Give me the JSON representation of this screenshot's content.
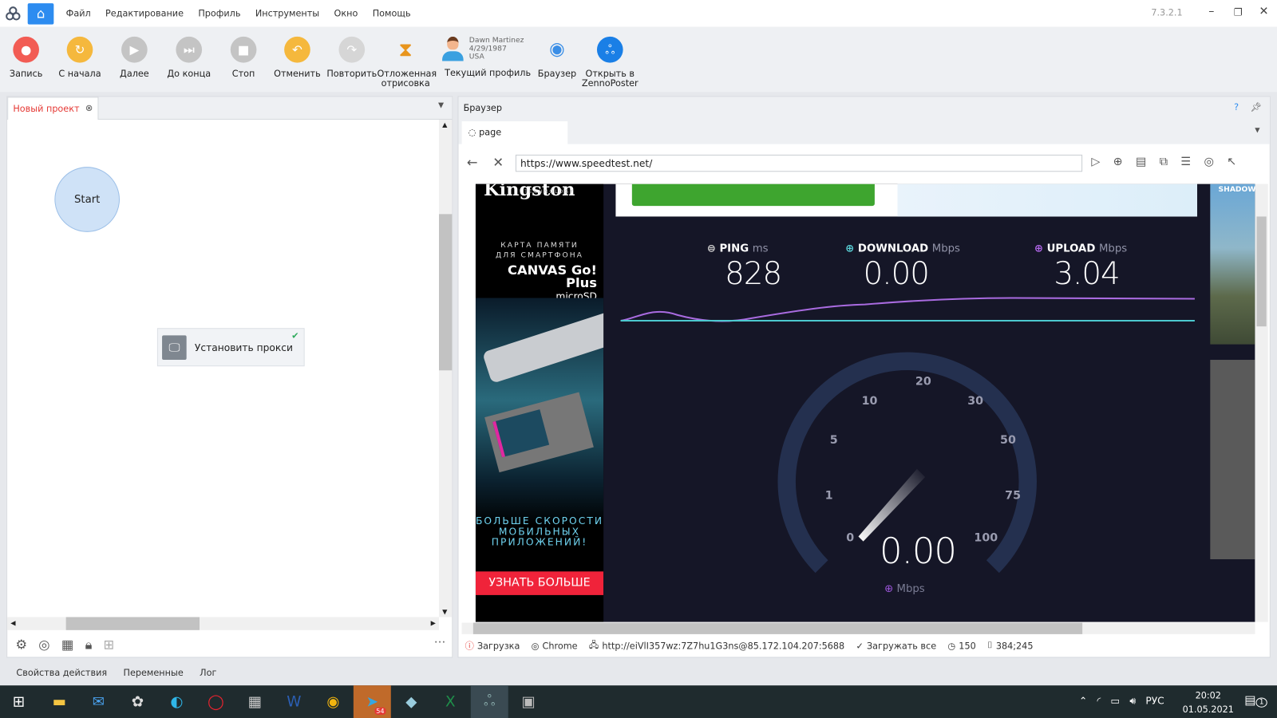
{
  "menu": {
    "items": [
      "Файл",
      "Редактирование",
      "Профиль",
      "Инструменты",
      "Окно",
      "Помощь"
    ],
    "version": "7.3.2.1"
  },
  "toolbar": {
    "record": "Запись",
    "restart": "С начала",
    "next": "Далее",
    "to_end": "До конца",
    "stop": "Стоп",
    "undo": "Отменить",
    "redo": "Повторить",
    "deferred_1": "Отложенная",
    "deferred_2": "отрисовка",
    "profile_name": "Dawn Martinez",
    "profile_dob": "4/29/1987",
    "profile_country": "USA",
    "current_profile": "Текущий профиль",
    "browser": "Браузер",
    "open_in_1": "Открыть в",
    "open_in_2": "ZennoPoster"
  },
  "project": {
    "tab": "Новый проект",
    "start": "Start",
    "action": "Установить прокси"
  },
  "bottom_tabs": [
    "Свойства действия",
    "Переменные",
    "Лог"
  ],
  "browser": {
    "title": "Браузер",
    "help": "?",
    "page_tab": "page",
    "url": "https://www.speedtest.net/"
  },
  "speedtest": {
    "ping_label": "PING",
    "ping_unit": "ms",
    "ping": "828",
    "download_label": "DOWNLOAD",
    "download_unit": "Mbps",
    "download": "0.00",
    "upload_label": "UPLOAD",
    "upload_unit": "Mbps",
    "upload": "3.04",
    "gauge_value": "0.00",
    "gauge_unit": "Mbps",
    "gauge_ticks": [
      "0",
      "1",
      "5",
      "10",
      "20",
      "30",
      "50",
      "75",
      "100"
    ]
  },
  "ad": {
    "brand": "Kingston",
    "brand_sub": "TECHNOLOGY",
    "line1": "КАРТА ПАМЯТИ",
    "line2": "ДЛЯ СМАРТФОНА",
    "product": "CANVAS Go! Plus",
    "product_sub": "microSD",
    "slogan1": "БОЛЬШЕ СКОРОСТИ",
    "slogan2": "МОБИЛЬНЫХ",
    "slogan3": "ПРИЛОЖЕНИЙ!",
    "cta": "УЗНАТЬ БОЛЬШЕ",
    "right_ad": "SHADOW"
  },
  "status": {
    "state": "Загрузка",
    "engine": "Chrome",
    "proxy": "http://eiVlI357wz:7Z7hu1G3ns@85.172.104.207:5688",
    "load": "Загружать все",
    "timeout": "150",
    "size": "384;245"
  },
  "taskbar": {
    "lang": "РУС",
    "time": "20:02",
    "date": "01.05.2021",
    "notif": "1",
    "telegram_badge": "54"
  }
}
